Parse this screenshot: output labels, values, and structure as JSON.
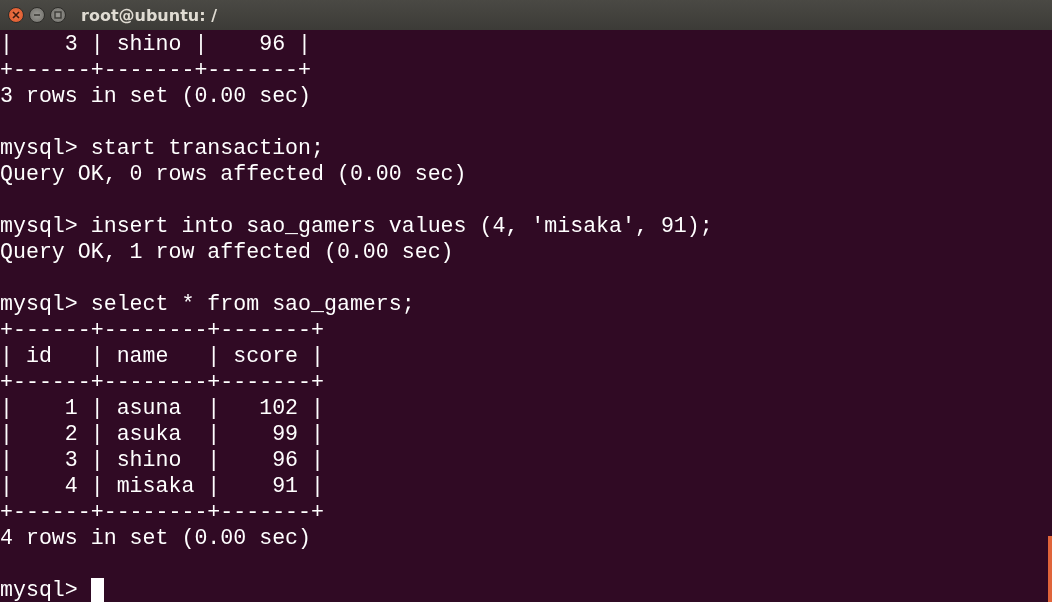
{
  "window": {
    "title": "root@ubuntu: /"
  },
  "terminal": {
    "blocks": [
      [
        "|    3 | shino |    96 |",
        "+------+-------+-------+",
        "3 rows in set (0.00 sec)"
      ],
      [
        "mysql> start transaction;",
        "Query OK, 0 rows affected (0.00 sec)"
      ],
      [
        "mysql> insert into sao_gamers values (4, 'misaka', 91);",
        "Query OK, 1 row affected (0.00 sec)"
      ],
      [
        "mysql> select * from sao_gamers;",
        "+------+--------+-------+",
        "| id   | name   | score |",
        "+------+--------+-------+",
        "|    1 | asuna  |   102 |",
        "|    2 | asuka  |    99 |",
        "|    3 | shino  |    96 |",
        "|    4 | misaka |    91 |",
        "+------+--------+-------+",
        "4 rows in set (0.00 sec)"
      ]
    ],
    "prompt": "mysql>"
  }
}
